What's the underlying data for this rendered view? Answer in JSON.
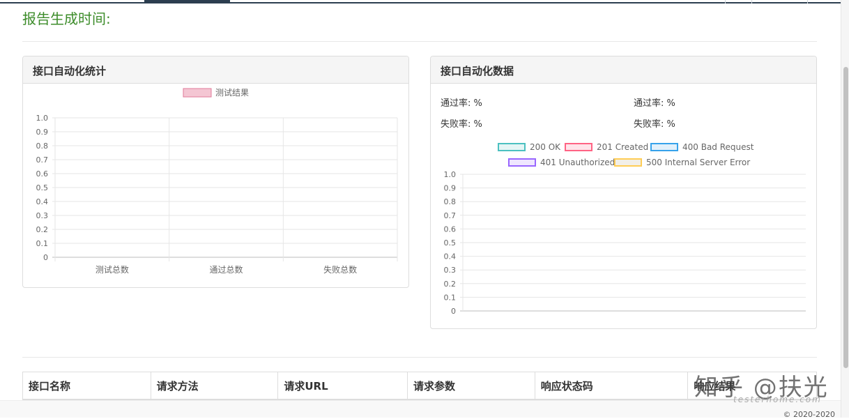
{
  "report": {
    "time_label": "报告生成时间:"
  },
  "stats_panel": {
    "title": "接口自动化统计",
    "chart_data": {
      "type": "bar",
      "legend": [
        "测试结果"
      ],
      "categories": [
        "测试总数",
        "通过总数",
        "失败总数"
      ],
      "series": [
        {
          "name": "测试结果",
          "values": []
        }
      ],
      "ylim": [
        0,
        1.0
      ],
      "yticks": [
        "1.0",
        "0.9",
        "0.8",
        "0.7",
        "0.6",
        "0.5",
        "0.4",
        "0.3",
        "0.2",
        "0.1",
        "0"
      ],
      "legend_position": "top",
      "grid": true,
      "colors": {
        "series": "#f4c6d3",
        "series_border": "#e07a9a"
      }
    }
  },
  "data_panel": {
    "title": "接口自动化数据",
    "pass_rate_label_1": "通过率:",
    "pass_rate_value_1": "%",
    "pass_rate_label_2": "通过率:",
    "pass_rate_value_2": "%",
    "fail_rate_label_1": "失败率:",
    "fail_rate_value_1": "%",
    "fail_rate_label_2": "失败率:",
    "fail_rate_value_2": "%",
    "chart_data": {
      "type": "line",
      "series": [
        {
          "name": "200 OK",
          "values": [],
          "color": "#4bc0c0"
        },
        {
          "name": "201 Created",
          "values": [],
          "color": "#ff6384"
        },
        {
          "name": "400 Bad Request",
          "values": [],
          "color": "#36a2eb"
        },
        {
          "name": "401 Unauthorized",
          "values": [],
          "color": "#9966ff"
        },
        {
          "name": "500 Internal Server Error",
          "values": [],
          "color": "#ffcd56"
        }
      ],
      "ylim": [
        0,
        1.0
      ],
      "yticks": [
        "1.0",
        "0.9",
        "0.8",
        "0.7",
        "0.6",
        "0.5",
        "0.4",
        "0.3",
        "0.2",
        "0.1",
        "0"
      ],
      "legend_position": "top",
      "grid": true
    }
  },
  "table": {
    "headers": [
      "接口名称",
      "请求方法",
      "请求URL",
      "请求参数",
      "响应状态码",
      "响应结果"
    ]
  },
  "footer": {
    "copyright": "© 2020-2020"
  },
  "watermark": {
    "main": "知乎 @扶光",
    "sub": "testerhome.com"
  }
}
